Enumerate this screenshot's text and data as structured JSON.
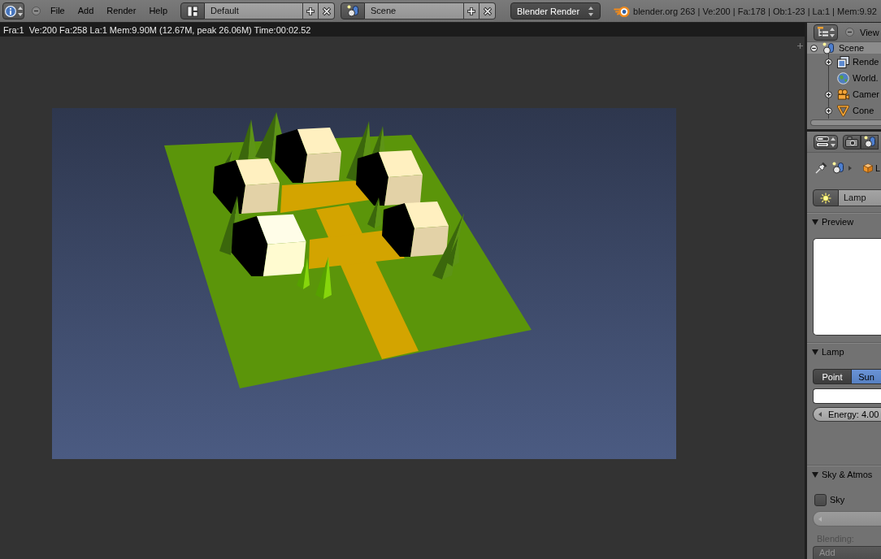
{
  "header": {
    "menus": [
      {
        "label": "File"
      },
      {
        "label": "Add"
      },
      {
        "label": "Render"
      },
      {
        "label": "Help"
      }
    ],
    "screen_layout": "Default",
    "scene": "Scene",
    "render_engine": "Blender Render",
    "stats": "blender.org 263 | Ve:200 | Fa:178 | Ob:1-23 | La:1 | Mem:9.92"
  },
  "render_view": {
    "info": "Fra:1  Ve:200 Fa:258 La:1 Mem:9.90M (12.67M, peak 26.06M) Time:00:02.52"
  },
  "outliner": {
    "menus": [
      {
        "label": "View"
      }
    ],
    "tree": [
      {
        "label": "Scene",
        "kind": "scene",
        "selected": true,
        "expandable": true,
        "expanded": true,
        "children": [
          {
            "label": "Rende",
            "kind": "render_layers",
            "selected": false,
            "expandable": true,
            "expanded": false
          },
          {
            "label": "World.",
            "kind": "world",
            "selected": false,
            "expandable": false,
            "expanded": false
          },
          {
            "label": "Camer",
            "kind": "camera",
            "selected": false,
            "expandable": true,
            "expanded": false
          },
          {
            "label": "Cone",
            "kind": "cone",
            "selected": false,
            "expandable": true,
            "expanded": false
          }
        ]
      }
    ]
  },
  "properties": {
    "context_tabs": [
      {
        "kind": "render",
        "selected": false
      },
      {
        "kind": "scene",
        "selected": false
      }
    ],
    "breadcrumb": [
      {
        "kind": "scene"
      },
      {
        "kind": "object",
        "label": "L"
      }
    ],
    "datablock": "Lamp",
    "panels": [
      {
        "title": "Preview",
        "kind": "preview",
        "expanded": true
      },
      {
        "title": "Lamp",
        "kind": "lamp",
        "expanded": true,
        "types": [
          {
            "label": "Point",
            "selected": false
          },
          {
            "label": "Sun",
            "selected": true
          }
        ],
        "energy": "Energy: 4.00"
      },
      {
        "title": "Sky & Atmos",
        "kind": "sky",
        "expanded": true,
        "sky": {
          "label": "Sky",
          "checked": false
        },
        "blending_label": "Blending:",
        "blending": "Add"
      }
    ]
  }
}
